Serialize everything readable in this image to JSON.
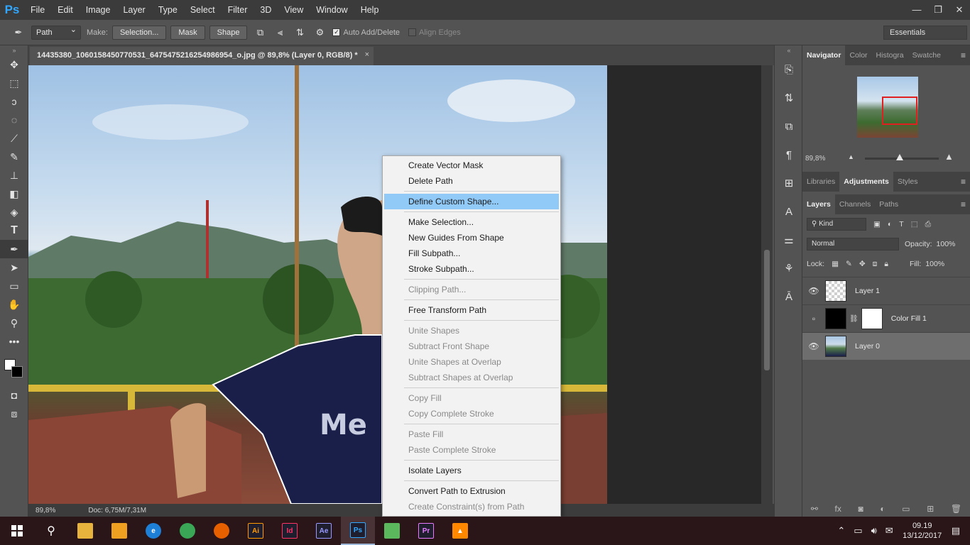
{
  "app": {
    "logo": "Ps"
  },
  "menu": [
    "File",
    "Edit",
    "Image",
    "Layer",
    "Type",
    "Select",
    "Filter",
    "3D",
    "View",
    "Window",
    "Help"
  ],
  "window_controls": [
    "—",
    "❐",
    "✕"
  ],
  "options_bar": {
    "mode": "Path",
    "make_label": "Make:",
    "selection_btn": "Selection...",
    "mask_btn": "Mask",
    "shape_btn": "Shape",
    "auto_add_delete": "Auto Add/Delete",
    "align_edges": "Align Edges",
    "workspace": "Essentials"
  },
  "document": {
    "tab_title": "14435380_1060158450770531_6475475216254986954_o.jpg @ 89,8% (Layer 0, RGB/8) *",
    "close": "×"
  },
  "status": {
    "zoom": "89,8%",
    "doc": "Doc: 6,75M/7,31M"
  },
  "context_menu": {
    "groups": [
      [
        {
          "label": "Create Vector Mask",
          "enabled": true
        },
        {
          "label": "Delete Path",
          "enabled": true
        }
      ],
      [
        {
          "label": "Define Custom Shape...",
          "enabled": true,
          "highlight": true
        }
      ],
      [
        {
          "label": "Make Selection...",
          "enabled": true
        },
        {
          "label": "New Guides From Shape",
          "enabled": true
        },
        {
          "label": "Fill Subpath...",
          "enabled": true
        },
        {
          "label": "Stroke Subpath...",
          "enabled": true
        }
      ],
      [
        {
          "label": "Clipping Path...",
          "enabled": false
        }
      ],
      [
        {
          "label": "Free Transform Path",
          "enabled": true
        }
      ],
      [
        {
          "label": "Unite Shapes",
          "enabled": false
        },
        {
          "label": "Subtract Front Shape",
          "enabled": false
        },
        {
          "label": "Unite Shapes at Overlap",
          "enabled": false
        },
        {
          "label": "Subtract Shapes at Overlap",
          "enabled": false
        }
      ],
      [
        {
          "label": "Copy Fill",
          "enabled": false
        },
        {
          "label": "Copy Complete Stroke",
          "enabled": false
        }
      ],
      [
        {
          "label": "Paste Fill",
          "enabled": false
        },
        {
          "label": "Paste Complete Stroke",
          "enabled": false
        }
      ],
      [
        {
          "label": "Isolate Layers",
          "enabled": true
        }
      ],
      [
        {
          "label": "Convert Path to Extrusion",
          "enabled": true
        },
        {
          "label": "Create Constraint(s) from Path",
          "enabled": false
        }
      ]
    ]
  },
  "navigator": {
    "tabs": [
      "Navigator",
      "Color",
      "Histogra",
      "Swatche"
    ],
    "zoom": "89,8%"
  },
  "adjustments_tabs": [
    "Libraries",
    "Adjustments",
    "Styles"
  ],
  "layers_panel": {
    "tabs": [
      "Layers",
      "Channels",
      "Paths"
    ],
    "filter": "Kind",
    "blend_mode": "Normal",
    "opacity_label": "Opacity:",
    "opacity": "100%",
    "lock_label": "Lock:",
    "fill_label": "Fill:",
    "fill": "100%",
    "layers": [
      {
        "name": "Layer 1",
        "visible": true,
        "selected": false
      },
      {
        "name": "Color Fill 1",
        "visible": false,
        "selected": false
      },
      {
        "name": "Layer 0",
        "visible": true,
        "selected": true
      }
    ]
  },
  "taskbar": {
    "apps": [
      {
        "name": "file-explorer",
        "glyph": "",
        "color": "#e8b33c"
      },
      {
        "name": "store",
        "glyph": "",
        "color": "#f0a020"
      },
      {
        "name": "edge",
        "glyph": "e",
        "color": "#1e7fd6"
      },
      {
        "name": "chrome",
        "glyph": "",
        "color": "#3aa757"
      },
      {
        "name": "firefox",
        "glyph": "",
        "color": "#e66000"
      },
      {
        "name": "illustrator",
        "glyph": "Ai",
        "color": "#ff9a00"
      },
      {
        "name": "indesign",
        "glyph": "Id",
        "color": "#ff3366"
      },
      {
        "name": "after-effects",
        "glyph": "Ae",
        "color": "#9999ff"
      },
      {
        "name": "photoshop",
        "glyph": "Ps",
        "color": "#31a8ff"
      },
      {
        "name": "camtasia",
        "glyph": "",
        "color": "#5bb85d"
      },
      {
        "name": "premiere",
        "glyph": "Pr",
        "color": "#e77bff"
      },
      {
        "name": "vlc",
        "glyph": "▲",
        "color": "#ff8800"
      }
    ],
    "time": "09.19",
    "date": "13/12/2017"
  }
}
